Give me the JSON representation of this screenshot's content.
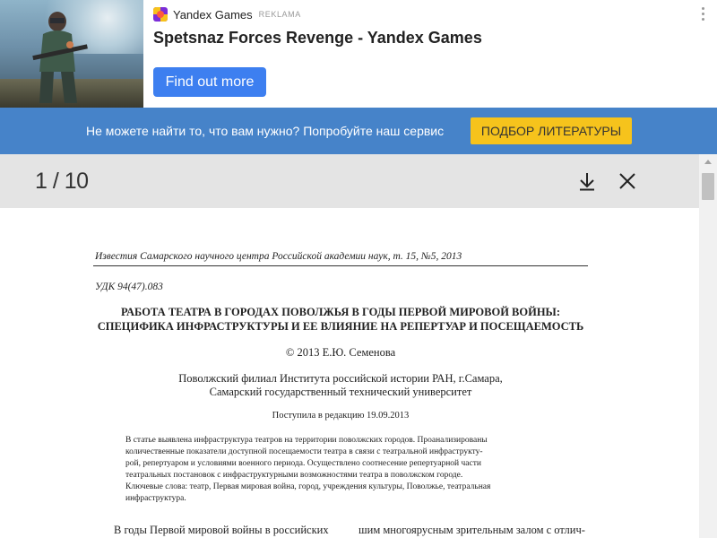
{
  "ad": {
    "brand": "Yandex Games",
    "label": "REKLAMA",
    "title": "Spetsnaz Forces Revenge - Yandex Games",
    "cta": "Find out more"
  },
  "promo": {
    "text": "Не можете найти то, что вам нужно? Попробуйте наш сервис",
    "button": "ПОДБОР ЛИТЕРАТУРЫ"
  },
  "viewer": {
    "page_indicator": "1 / 10",
    "icons": [
      "download-icon",
      "close-icon"
    ]
  },
  "document": {
    "journal": "Известия Самарского научного центра Российской академии наук, т. 15, №5, 2013",
    "udk": "УДК 94(47).083",
    "title_line1": "РАБОТА ТЕАТРА В ГОРОДАХ ПОВОЛЖЬЯ В ГОДЫ ПЕРВОЙ МИРОВОЙ ВОЙНЫ:",
    "title_line2": "СПЕЦИФИКА ИНФРАСТРУКТУРЫ И ЕЕ ВЛИЯНИЕ НА РЕПЕРТУАР И ПОСЕЩАЕМОСТЬ",
    "copyright": "© 2013 Е.Ю. Семенова",
    "affiliation_line1": "Поволжский филиал Института российской истории РАН, г.Самара,",
    "affiliation_line2": "Самарский государственный технический университет",
    "received": "Поступила в редакцию 19.09.2013",
    "abstract_lines": [
      "В статье выявлена инфраструктура театров на территории поволжских городов. Проанализированы",
      "количественные показатели доступной посещаемости театра в связи с театральной инфраструкту-",
      "рой, репертуаром и условиями военного периода. Осуществлено соотнесение репертуарной части",
      "театральных постановок с инфраструктурными возможностями театра в поволжском городе.",
      "Ключевые слова: театр, Первая мировая война, город, учреждения культуры, Поволжье, театральная",
      "инфраструктура."
    ],
    "body_left": "В годы Первой мировой войны в российских",
    "body_right": "шим многоярусным зрительным залом с отлич-"
  }
}
